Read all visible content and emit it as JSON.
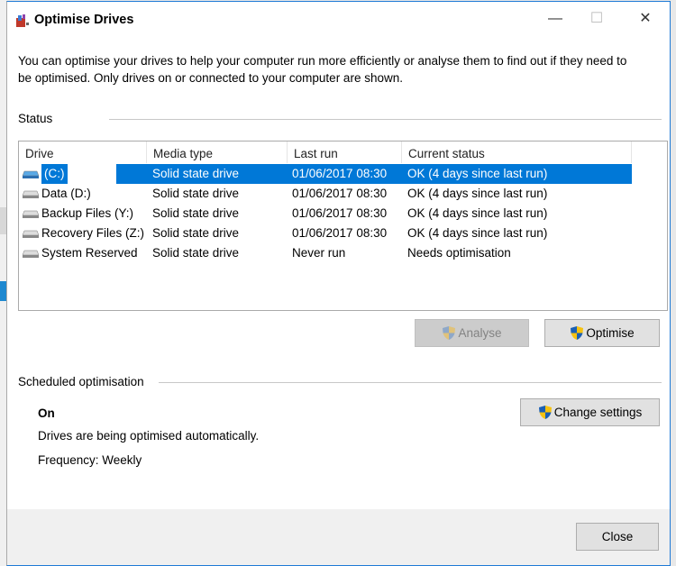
{
  "window": {
    "title": "Optimise Drives",
    "minimize": "—",
    "maximize": "☐",
    "close": "✕"
  },
  "description": "You can optimise your drives to help your computer run more efficiently or analyse them to find out if they need to be optimised. Only drives on or connected to your computer are shown.",
  "status": {
    "label": "Status",
    "columns": [
      "Drive",
      "Media type",
      "Last run",
      "Current status"
    ],
    "rows": [
      {
        "drive": "(C:)",
        "media": "Solid state drive",
        "last_run": "01/06/2017 08:30",
        "status": "OK (4 days since last run)",
        "selected": true,
        "icon": "windows-drive-icon"
      },
      {
        "drive": "Data (D:)",
        "media": "Solid state drive",
        "last_run": "01/06/2017 08:30",
        "status": "OK (4 days since last run)",
        "icon": "drive-icon"
      },
      {
        "drive": "Backup Files (Y:)",
        "media": "Solid state drive",
        "last_run": "01/06/2017 08:30",
        "status": "OK (4 days since last run)",
        "icon": "drive-icon"
      },
      {
        "drive": "Recovery Files (Z:)",
        "media": "Solid state drive",
        "last_run": "01/06/2017 08:30",
        "status": "OK (4 days since last run)",
        "icon": "drive-icon"
      },
      {
        "drive": "System Reserved",
        "media": "Solid state drive",
        "last_run": "Never run",
        "status": "Needs optimisation",
        "icon": "drive-icon"
      }
    ]
  },
  "buttons": {
    "analyse": "Analyse",
    "optimise": "Optimise",
    "change_settings": "Change settings",
    "close": "Close"
  },
  "scheduled": {
    "label": "Scheduled optimisation",
    "state": "On",
    "message": "Drives are being optimised automatically.",
    "frequency": "Frequency: Weekly"
  },
  "colors": {
    "selection": "#0078d7",
    "accent_border": "#1f7ad6"
  }
}
